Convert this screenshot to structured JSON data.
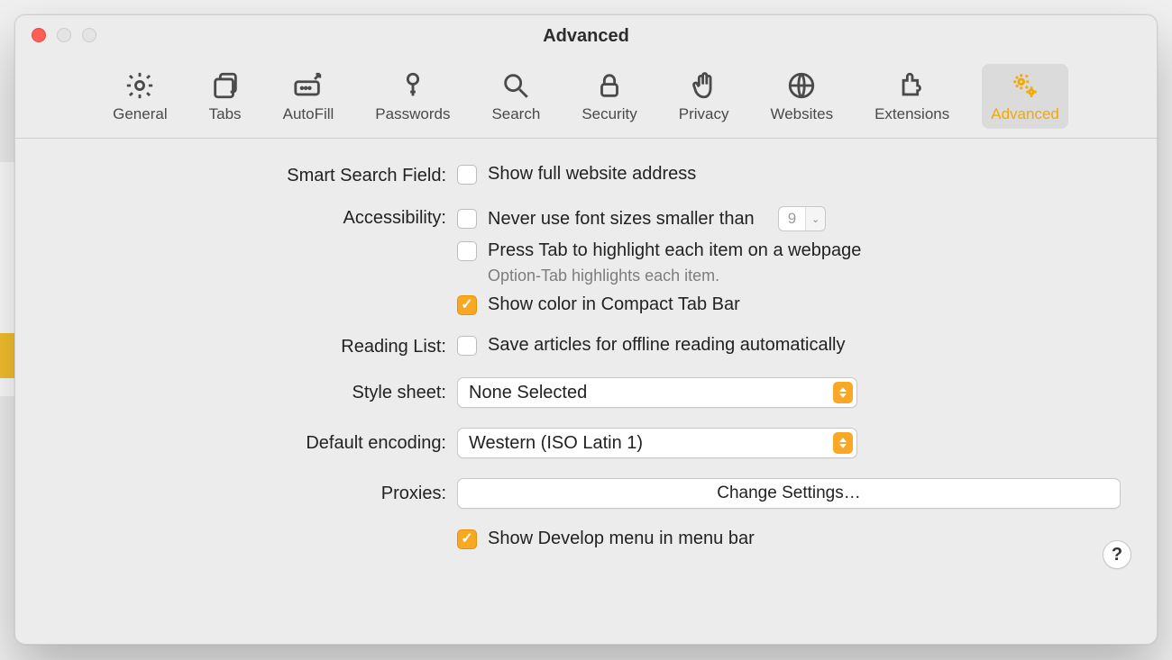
{
  "window": {
    "title": "Advanced"
  },
  "tabs": [
    {
      "label": "General"
    },
    {
      "label": "Tabs"
    },
    {
      "label": "AutoFill"
    },
    {
      "label": "Passwords"
    },
    {
      "label": "Search"
    },
    {
      "label": "Security"
    },
    {
      "label": "Privacy"
    },
    {
      "label": "Websites"
    },
    {
      "label": "Extensions"
    },
    {
      "label": "Advanced"
    }
  ],
  "sections": {
    "smartSearch": {
      "label": "Smart Search Field:",
      "showFullAddress": {
        "text": "Show full website address",
        "checked": false
      }
    },
    "accessibility": {
      "label": "Accessibility:",
      "fontSize": {
        "text": "Never use font sizes smaller than",
        "checked": false,
        "value": "9"
      },
      "tabHighlight": {
        "text": "Press Tab to highlight each item on a webpage",
        "checked": false
      },
      "tabHint": "Option-Tab highlights each item.",
      "compactColor": {
        "text": "Show color in Compact Tab Bar",
        "checked": true
      }
    },
    "readingList": {
      "label": "Reading List:",
      "saveOffline": {
        "text": "Save articles for offline reading automatically",
        "checked": false
      }
    },
    "styleSheet": {
      "label": "Style sheet:",
      "value": "None Selected"
    },
    "encoding": {
      "label": "Default encoding:",
      "value": "Western (ISO Latin 1)"
    },
    "proxies": {
      "label": "Proxies:",
      "button": "Change Settings…"
    },
    "develop": {
      "text": "Show Develop menu in menu bar",
      "checked": true
    }
  },
  "help": "?"
}
